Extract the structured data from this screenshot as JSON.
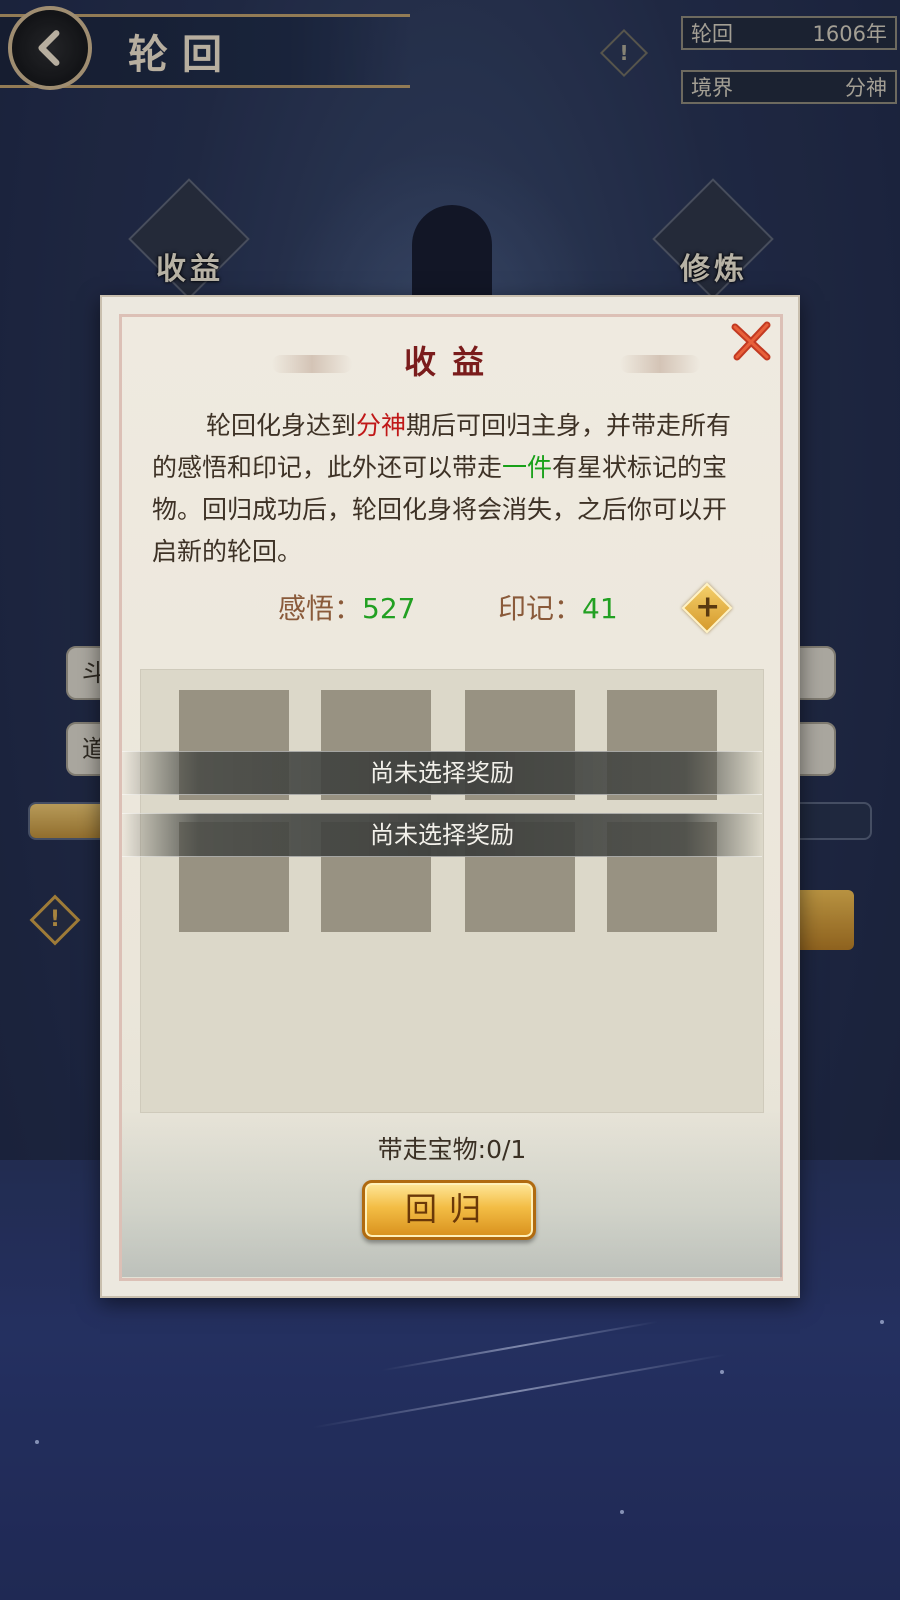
{
  "header": {
    "title": "轮回",
    "back_icon": "chevron-left-icon"
  },
  "status": {
    "cycle_label": "轮回",
    "cycle_value": "1606年",
    "realm_label": "境界",
    "realm_value": "分神"
  },
  "background": {
    "side_left_label": "收益",
    "side_right_label": "修炼",
    "field1_text": "斗",
    "field2_text": "道"
  },
  "dialog": {
    "title": "收益",
    "desc_part1": "轮回化身达到",
    "desc_hl1": "分神",
    "desc_part2": "期后可回归主身，并带走所有的感悟和印记，此外还可以带走",
    "desc_hl2": "一件",
    "desc_part3": "有星状标记的宝物。回归成功后，轮回化身将会消失，之后你可以开启新的轮回。",
    "insight_label": "感悟：",
    "insight_value": "527",
    "mark_label": "印记：",
    "mark_value": "41",
    "reward_banner_1": "尚未选择奖励",
    "reward_banner_2": "尚未选择奖励",
    "carry_text": "带走宝物:0/1",
    "return_button": "回归"
  },
  "colors": {
    "highlight_red": "#c01818",
    "highlight_green": "#18a018",
    "gold_button": "#f3bd45"
  }
}
